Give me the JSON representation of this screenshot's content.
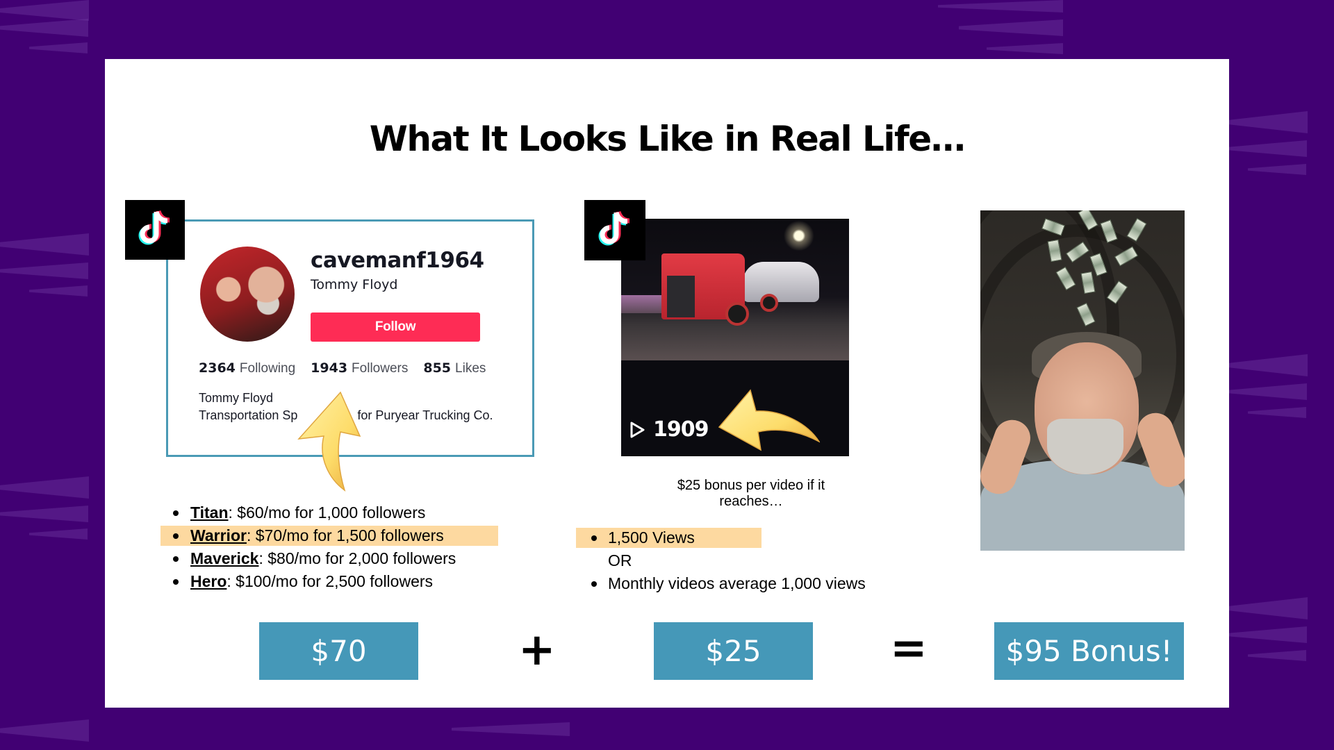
{
  "slide": {
    "title": "What It Looks Like in Real Life…",
    "colors": {
      "background": "#410073",
      "accent_box": "#4598B8",
      "highlight": "#FDD9A0",
      "follow_button": "#FE2C55",
      "profile_border": "#4A9AB5"
    }
  },
  "profile": {
    "platform_icon": "tiktok-icon",
    "username": "cavemanf1964",
    "display_name": "Tommy Floyd",
    "follow_label": "Follow",
    "stats": [
      {
        "value": "2364",
        "label": "Following"
      },
      {
        "value": "1943",
        "label": "Followers"
      },
      {
        "value": "855",
        "label": "Likes"
      }
    ],
    "bio_line1": "Tommy Floyd",
    "bio_line2_visible_start": "Transportation Sp",
    "bio_line2_visible_end": "for Puryear Trucking Co."
  },
  "tiers": [
    {
      "name": "Titan",
      "desc": ": $60/mo for 1,000 followers",
      "highlighted": false
    },
    {
      "name": "Warrior",
      "desc": ": $70/mo for 1,500 followers",
      "highlighted": true
    },
    {
      "name": "Maverick",
      "desc": ": $80/mo for 2,000 followers",
      "highlighted": false
    },
    {
      "name": "Hero",
      "desc": ": $100/mo for 2,500 followers",
      "highlighted": false
    }
  ],
  "video": {
    "platform_icon": "tiktok-icon",
    "play_icon": "play-icon",
    "view_count": "1909",
    "bonus_caption": "$25 bonus per video if it reaches…",
    "conditions": [
      {
        "text": "1,500 Views",
        "highlighted": true
      },
      {
        "text": "Monthly videos average 1,000 views",
        "highlighted": false
      }
    ],
    "or_label": "OR"
  },
  "equation": {
    "term1": "$70",
    "plus": "+",
    "term2": "$25",
    "equals": "=",
    "result": "$95 Bonus!"
  }
}
